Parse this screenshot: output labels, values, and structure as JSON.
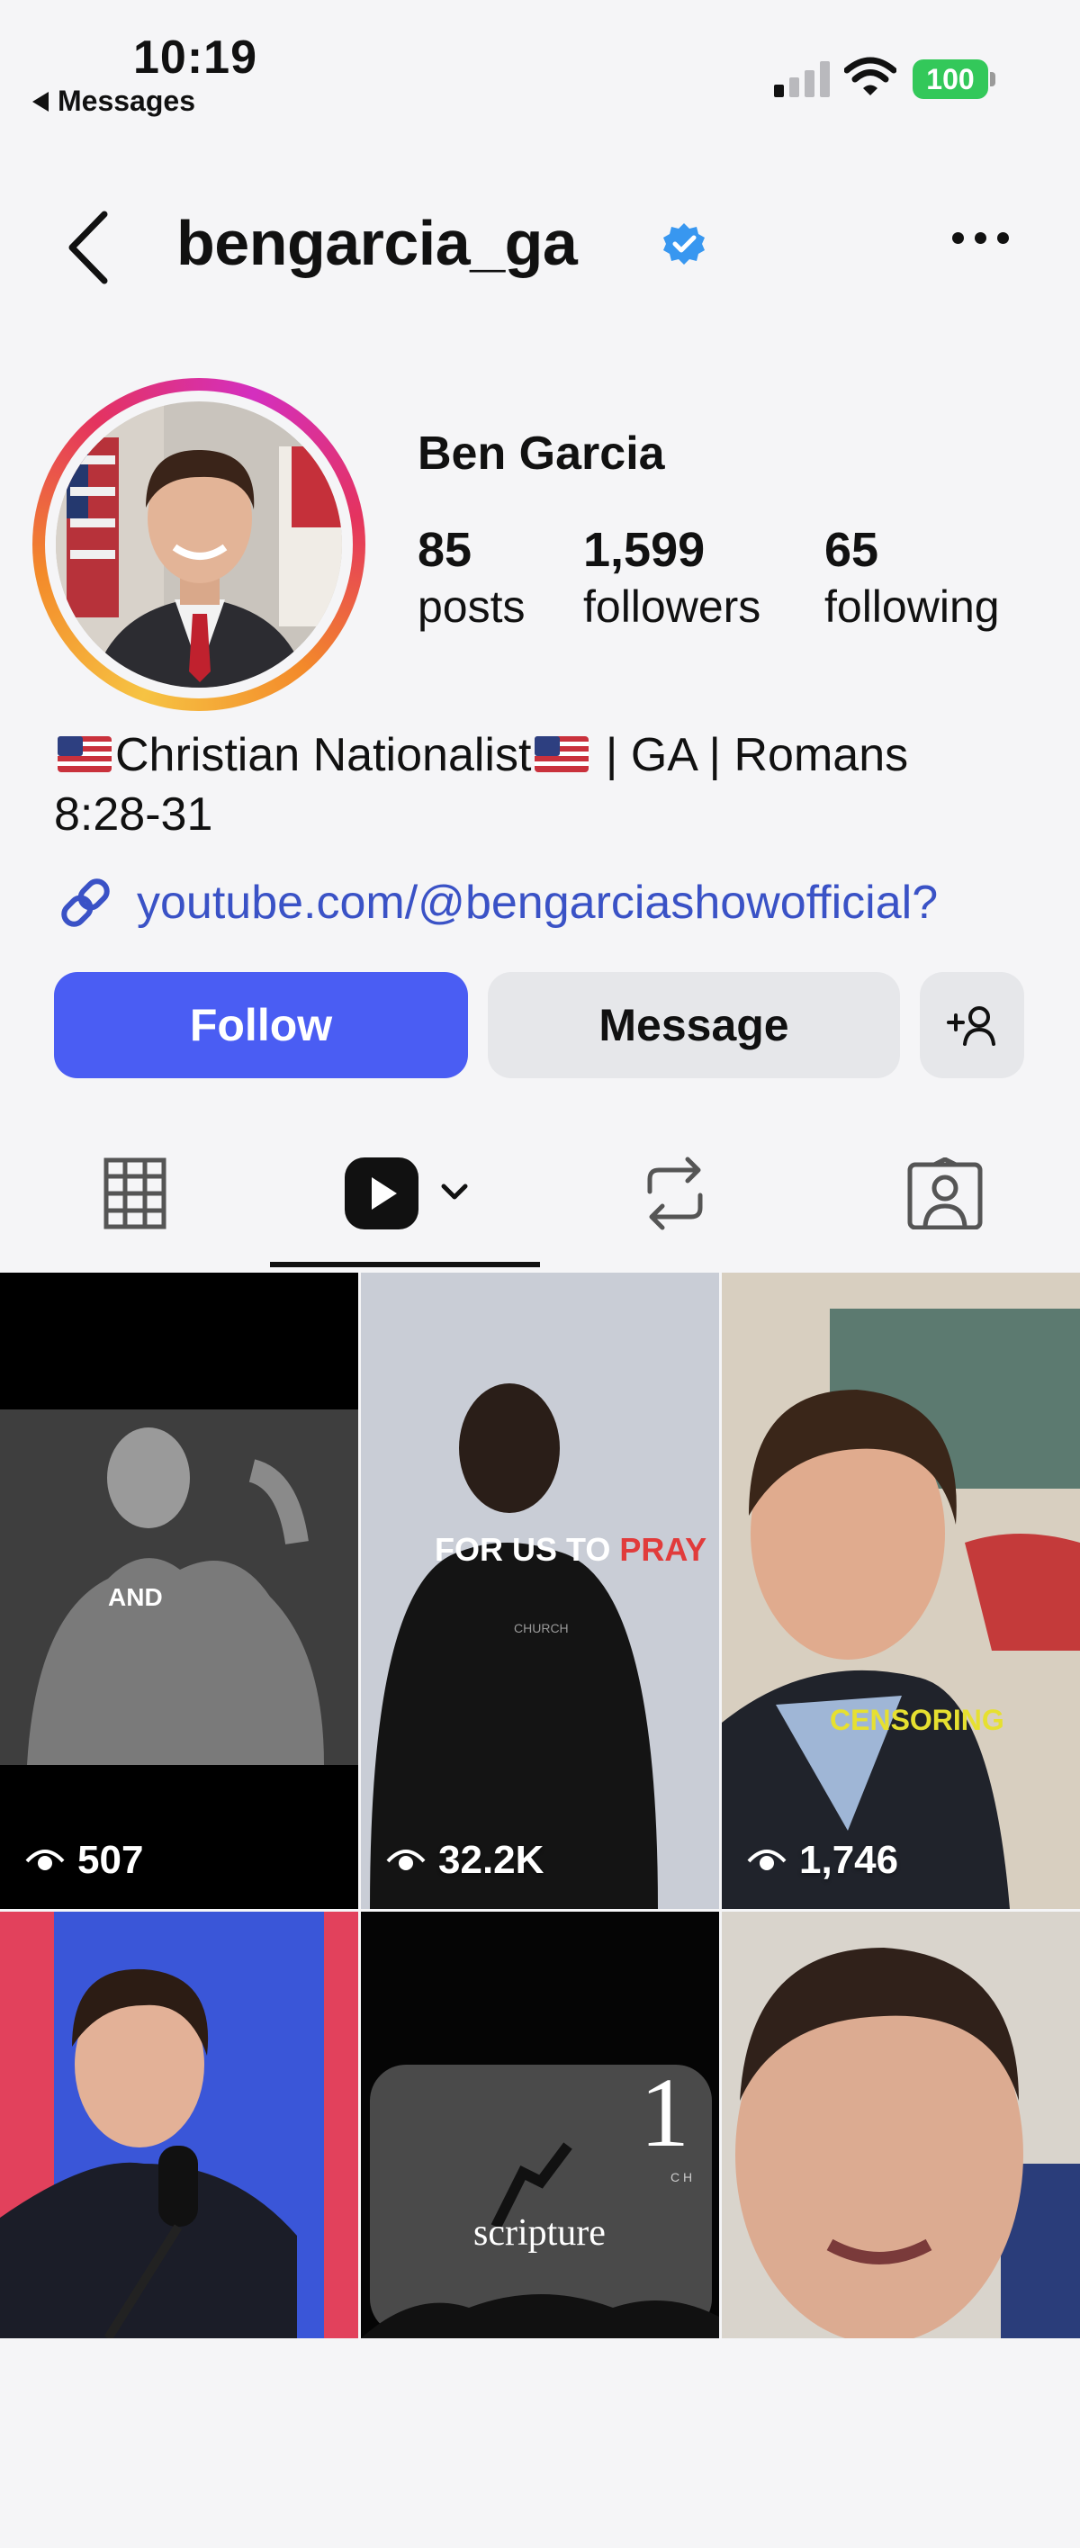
{
  "status_bar": {
    "time": "10:19",
    "back_label": "Messages",
    "battery": "100"
  },
  "header": {
    "username": "bengarcia_ga"
  },
  "profile": {
    "display_name": "Ben Garcia",
    "stats": [
      {
        "value": "85",
        "label": "posts"
      },
      {
        "value": "1,599",
        "label": "followers"
      },
      {
        "value": "65",
        "label": "following"
      }
    ],
    "bio_part1": "Christian Nationalist",
    "bio_part2": " | GA | Romans",
    "bio_line2": "8:28-31",
    "link": "youtube.com/@bengarciashowofficial?"
  },
  "actions": {
    "follow": "Follow",
    "message": "Message"
  },
  "colors": {
    "accent": "#4a5df3",
    "link": "#3a52c6",
    "verified": "#3897f0"
  },
  "tabs": [
    {
      "icon": "grid-icon"
    },
    {
      "icon": "reels-icon",
      "selected": true
    },
    {
      "icon": "reposts-icon"
    },
    {
      "icon": "tagged-icon"
    }
  ],
  "grid": [
    {
      "caption": "AND",
      "views": "507"
    },
    {
      "caption_white": "FOR US TO ",
      "caption_red": "PRAY",
      "shirt": "CHURCH",
      "views": "32.2K"
    },
    {
      "caption": "CENSORING",
      "views": "1,746"
    },
    {
      "caption": ""
    },
    {
      "caption": "scripture",
      "corner": "1",
      "corner_small": "C H"
    },
    {
      "caption": ""
    }
  ]
}
